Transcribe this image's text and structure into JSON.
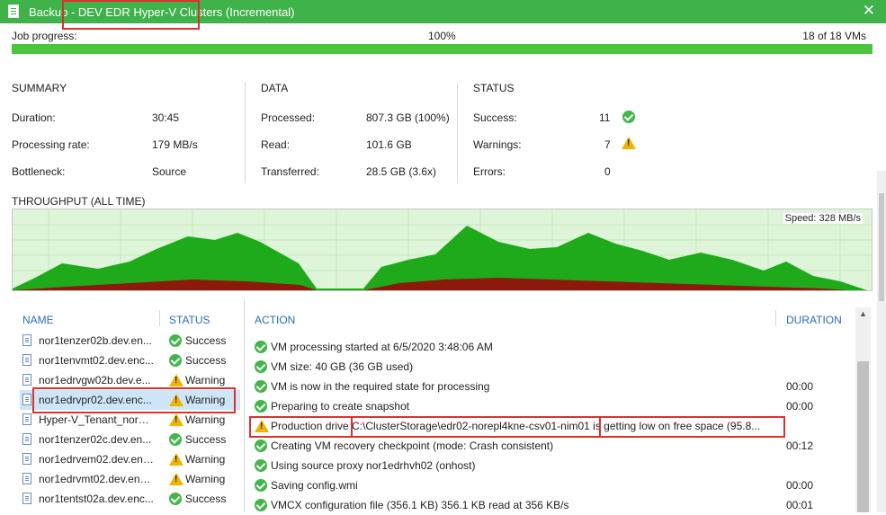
{
  "window": {
    "title": "Backup - DEV EDR Hyper-V Clusters (Incremental)",
    "close": "✕"
  },
  "progress": {
    "label": "Job progress:",
    "percent_text": "100%",
    "percent": 100,
    "vms": "18 of 18 VMs"
  },
  "summary": {
    "title": "SUMMARY",
    "items": [
      {
        "label": "Duration:",
        "value": "30:45"
      },
      {
        "label": "Processing rate:",
        "value": "179 MB/s"
      },
      {
        "label": "Bottleneck:",
        "value": "Source"
      }
    ]
  },
  "data": {
    "title": "DATA",
    "items": [
      {
        "label": "Processed:",
        "value": "807.3 GB (100%)"
      },
      {
        "label": "Read:",
        "value": "101.6 GB"
      },
      {
        "label": "Transferred:",
        "value": "28.5 GB (3.6x)"
      }
    ]
  },
  "status": {
    "title": "STATUS",
    "items": [
      {
        "label": "Success:",
        "value": "11",
        "icon": "check-icon"
      },
      {
        "label": "Warnings:",
        "value": "7",
        "icon": "warning-icon"
      },
      {
        "label": "Errors:",
        "value": "0",
        "icon": ""
      }
    ]
  },
  "throughput": {
    "title": "THROUGHPUT (ALL TIME)",
    "speed": "Speed: 328 MB/s"
  },
  "colors": {
    "title_bar": "#3fb24a",
    "progress_fill": "#4bc540",
    "success": "#43b649",
    "warning": "#f0b400",
    "highlight": "#d9322f",
    "chart_green": "#1faa1c",
    "chart_red": "#8b1a0a"
  },
  "vm_list": {
    "headers": {
      "name": "NAME",
      "status": "STATUS"
    },
    "rows": [
      {
        "name": "nor1tenzer02b.dev.en...",
        "status": "Success",
        "icon": "success"
      },
      {
        "name": "nor1tenvmt02.dev.enc...",
        "status": "Success",
        "icon": "success"
      },
      {
        "name": "nor1edrvgw02b.dev.e...",
        "status": "Warning",
        "icon": "warning"
      },
      {
        "name": "nor1edrvpr02.dev.enc...",
        "status": "Warning",
        "icon": "warning"
      },
      {
        "name": "Hyper-V_Tenant_nor1t...",
        "status": "Warning",
        "icon": "warning"
      },
      {
        "name": "nor1tenzer02c.dev.en...",
        "status": "Success",
        "icon": "success"
      },
      {
        "name": "nor1edrvem02.dev.enc...",
        "status": "Warning",
        "icon": "warning"
      },
      {
        "name": "nor1edrvmt02.dev.enc...",
        "status": "Warning",
        "icon": "warning"
      },
      {
        "name": "nor1tentst02a.dev.enc...",
        "status": "Success",
        "icon": "success"
      }
    ]
  },
  "actions": {
    "headers": {
      "action": "ACTION",
      "duration": "DURATION"
    },
    "rows": [
      {
        "text": "VM processing started at 6/5/2020 3:48:06 AM",
        "duration": "",
        "icon": "success"
      },
      {
        "text": "VM size: 40 GB (36 GB used)",
        "duration": "",
        "icon": "success"
      },
      {
        "text": "VM is now in the required state for processing",
        "duration": "00:00",
        "icon": "success"
      },
      {
        "text": "Preparing to create snapshot",
        "duration": "00:00",
        "icon": "success"
      },
      {
        "text": "Production drive C:\\ClusterStorage\\edr02-norepl4kne-csv01-nim01 is getting low on free space (95.8...",
        "duration": "",
        "icon": "warning"
      },
      {
        "text": "Creating VM recovery checkpoint (mode: Crash consistent)",
        "duration": "00:12",
        "icon": "success"
      },
      {
        "text": "Using source proxy nor1edrhvh02 (onhost)",
        "duration": "",
        "icon": "success"
      },
      {
        "text": "Saving config.wmi",
        "duration": "00:00",
        "icon": "success"
      },
      {
        "text": "VMCX configuration file (356.1 KB) 356.1 KB read at 356 KB/s",
        "duration": "00:01",
        "icon": "success"
      }
    ]
  }
}
